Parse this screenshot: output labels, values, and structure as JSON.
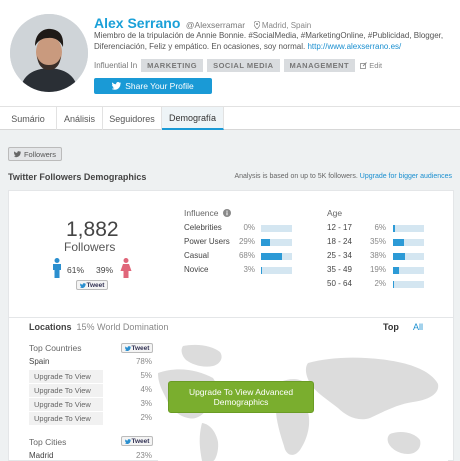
{
  "profile": {
    "name": "Alex Serrano",
    "handle": "@Alexserramar",
    "location": "Madrid, Spain",
    "bio": "Miembro de la tripulación de Annie Bonnie. #SocialMedia, #MarketingOnline, #Publicidad, Blogger, Diferenciación, Feliz y empático. En ocasiones, soy normal.",
    "bio_link": "http://www.alexserrano.es/",
    "influential_label": "Influential In",
    "tags": [
      "MARKETING",
      "SOCIAL MEDIA",
      "MANAGEMENT"
    ],
    "edit_label": "Edit",
    "share_label": "Share Your Profile"
  },
  "tabs": [
    {
      "label": "Sumário"
    },
    {
      "label": "Análisis"
    },
    {
      "label": "Seguidores"
    },
    {
      "label": "Demografía"
    }
  ],
  "filter": {
    "followers_label": "Followers"
  },
  "demographics": {
    "title": "Twitter Followers Demographics",
    "analysis_text": "Analysis is based on up to 5K followers.",
    "upgrade_link": "Upgrade for bigger audiences",
    "followers_count": "1,882",
    "followers_label": "Followers",
    "male_pct": "61%",
    "female_pct": "39%",
    "tweet_label": "Tweet"
  },
  "influence": {
    "heading": "Influence",
    "rows": [
      {
        "label": "Celebrities",
        "pct": "0%",
        "value": 0
      },
      {
        "label": "Power Users",
        "pct": "29%",
        "value": 29
      },
      {
        "label": "Casual",
        "pct": "68%",
        "value": 68
      },
      {
        "label": "Novice",
        "pct": "3%",
        "value": 3
      }
    ]
  },
  "age": {
    "heading": "Age",
    "rows": [
      {
        "label": "12 - 17",
        "pct": "6%",
        "value": 6
      },
      {
        "label": "18 - 24",
        "pct": "35%",
        "value": 35
      },
      {
        "label": "25 - 34",
        "pct": "38%",
        "value": 38
      },
      {
        "label": "35 - 49",
        "pct": "19%",
        "value": 19
      },
      {
        "label": "50 - 64",
        "pct": "2%",
        "value": 2
      }
    ]
  },
  "locations": {
    "title": "Locations",
    "subtitle": "15% World Domination",
    "top_label": "Top",
    "all_label": "All",
    "top_countries_label": "Top Countries",
    "countries": [
      {
        "name": "Spain",
        "pct": "78%"
      },
      {
        "name": "Upgrade To View",
        "pct": "5%"
      },
      {
        "name": "Upgrade To View",
        "pct": "4%"
      },
      {
        "name": "Upgrade To View",
        "pct": "3%"
      },
      {
        "name": "Upgrade To View",
        "pct": "2%"
      }
    ],
    "top_cities_label": "Top Cities",
    "cities": [
      {
        "name": "Madrid",
        "pct": "23%"
      }
    ],
    "upgrade_button": "Upgrade To View Advanced Demographics",
    "map_colors": {
      "land": "#d9d9d9",
      "highlight": "#1a7fc4"
    }
  }
}
